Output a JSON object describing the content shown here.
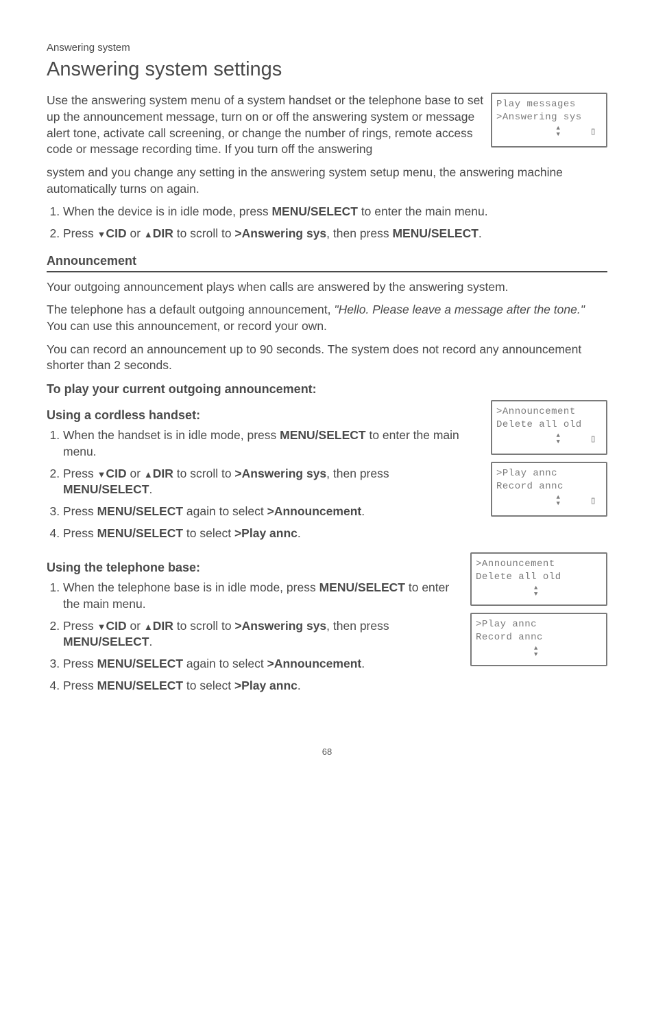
{
  "crumbs": "Answering system",
  "title": "Answering system settings",
  "intro_part1": "Use the answering system menu of a system handset or the telephone base to set up the announcement message, turn on or off the answering system or message alert tone, activate call screening, or change the number of rings, remote access code or message recording time. If you turn off the answering",
  "intro_part2": "system and you change any setting in the answering system setup menu, the answering machine automatically turns on again.",
  "lcd_top": {
    "l1": " Play messages",
    "l2": ">Answering sys"
  },
  "main_steps": {
    "s1": "When the device is in idle mode, press ",
    "s1b": "MENU/",
    "s1c": "SELECT",
    "s1d": " to enter the main menu.",
    "s2a": "Press ",
    "s2_cid": "CID",
    "s2_or": " or ",
    "s2_dir": "DIR",
    "s2b": " to scroll to ",
    "s2_target": ">Answering sys",
    "s2c": ", then press ",
    "s2_menu": "MENU",
    "s2_select": "/SELECT",
    "s2d": "."
  },
  "ann_head": "Announcement",
  "ann_p1": "Your outgoing announcement plays when calls are answered by the answering system.",
  "ann_p2a": "The telephone has a default outgoing announcement, ",
  "ann_quote": "\"Hello. Please leave a message after the tone.\"",
  "ann_p2b": " You can use this announcement, or record your own.",
  "ann_p3": "You can record an announcement up to 90 seconds. The system does not record any announcement shorter than 2 seconds.",
  "play_head": "To play your current outgoing announcement:",
  "cordless_head": "Using a cordless handset:",
  "cordless": {
    "c1a": "When the handset is in idle mode, press ",
    "c1b": "MENU/",
    "c1c": "SELECT",
    "c1d": " to enter the main menu.",
    "c2a": "Press ",
    "c2b": " to scroll to ",
    "c2_target": ">Answering sys",
    "c2c": ", then press ",
    "c2d": ".",
    "c3a": "Press ",
    "c3b": " again to select ",
    "c3_target": ">Announcement",
    "c3c": ".",
    "c4a": "Press ",
    "c4b": " to select ",
    "c4_target": ">Play annc",
    "c4c": "."
  },
  "base_head": "Using the telephone base:",
  "base": {
    "b1a": "When the telephone base is in idle mode, press ",
    "b1b": "MENU/",
    "b1c": "SELECT",
    "b1d": " to enter the main menu.",
    "b2a": "Press ",
    "b2b": " to scroll to ",
    "b2_target": ">Answering sys",
    "b2c": ", then press ",
    "b2d": ".",
    "b3a": "Press ",
    "b3b": " again to select ",
    "b3_target": ">Announcement",
    "b3c": ".",
    "b4a": "Press ",
    "b4b": " to select ",
    "b4_target": ">Play annc",
    "b4c": "."
  },
  "lcd_ann": {
    "l1": ">Announcement",
    "l2": " Delete all old"
  },
  "lcd_play": {
    "l1": ">Play annc",
    "l2": " Record annc"
  },
  "lcd_ann2": {
    "l1": ">Announcement",
    "l2": " Delete all old"
  },
  "lcd_play2": {
    "l1": ">Play annc",
    "l2": " Record annc"
  },
  "labels": {
    "cid": "CID",
    "dir": "DIR",
    "menu": "MENU",
    "select": "/SELECT"
  },
  "page": "68"
}
